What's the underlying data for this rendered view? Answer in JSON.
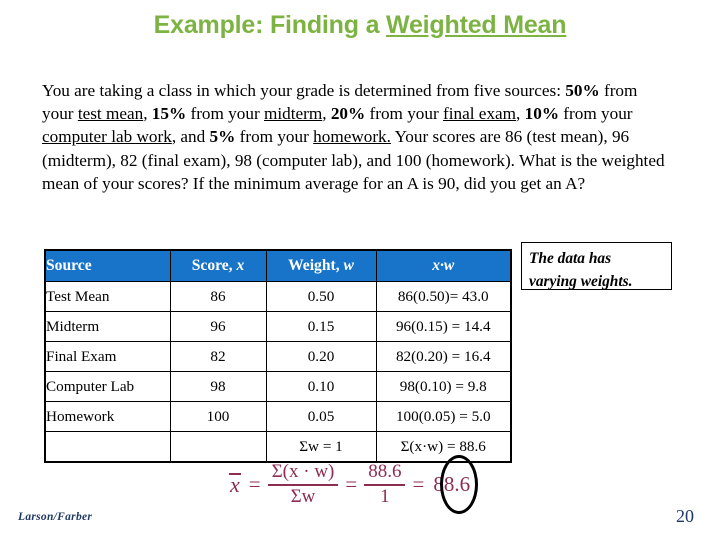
{
  "slide": {
    "title_prefix": "Example: Finding a ",
    "title_underlined": "Weighted Mean",
    "problem_line1_a": "You are taking a class in which your grade is determined from five sources: ",
    "problem_p50": "50%",
    "problem_line1_b": " from your ",
    "problem_test_mean": "test mean",
    "problem_line1_c": ", ",
    "problem_p15": "15%",
    "problem_line1_d": " from your ",
    "problem_midterm": "midterm",
    "problem_line1_e": ", ",
    "problem_p20": "20%",
    "problem_line1_f": " from your ",
    "problem_final_exam": "final exam",
    "problem_line1_g": ", ",
    "problem_p10": "10%",
    "problem_line1_h": " from your ",
    "problem_computer_lab": "computer lab work",
    "problem_line1_i": ", and ",
    "problem_p5": "5%",
    "problem_line1_j": " from your ",
    "problem_homework": "homework.",
    "problem_line2": " Your scores are 86 (test mean), 96 (midterm), 82 (final exam), 98 (computer lab), and 100 (homework). What is the weighted mean of your scores? If the minimum average for an A is 90, did you get an A?",
    "callout_line1": "The data has",
    "callout_line2": "varying weights.",
    "credit": "Larson/Farber",
    "page_number": "20"
  },
  "table": {
    "headers": {
      "source": "Source",
      "score_label": "Score, ",
      "score_var": "x",
      "weight_label": "Weight, ",
      "weight_var": "w",
      "product": "x·w"
    },
    "rows": [
      {
        "source": "Test Mean",
        "score": "86",
        "weight": "0.50",
        "xw": "86(0.50)= 43.0"
      },
      {
        "source": "Midterm",
        "score": "96",
        "weight": "0.15",
        "xw": "96(0.15) = 14.4"
      },
      {
        "source": "Final Exam",
        "score": "82",
        "weight": "0.20",
        "xw": "82(0.20) = 16.4"
      },
      {
        "source": "Computer Lab",
        "score": "98",
        "weight": "0.10",
        "xw": "98(0.10) = 9.8"
      },
      {
        "source": "Homework",
        "score": "100",
        "weight": "0.05",
        "xw": "100(0.05) = 5.0"
      }
    ],
    "totals": {
      "source": "",
      "score": "",
      "weight": "Σw  = 1",
      "xw": "Σ(x·w)  = 88.6"
    }
  },
  "formula": {
    "lhs_var": "x",
    "equals1": "=",
    "frac1_num": "Σ(x · w)",
    "frac1_den": "Σw",
    "equals2": "=",
    "frac2_num": "88.6",
    "frac2_den": "1",
    "equals3": "=",
    "answer": "88.6"
  },
  "colors": {
    "title_green": "#7CB342",
    "header_blue": "#1874C8",
    "accent_maroon": "#8E2C52",
    "footer_navy": "#1F3864"
  }
}
